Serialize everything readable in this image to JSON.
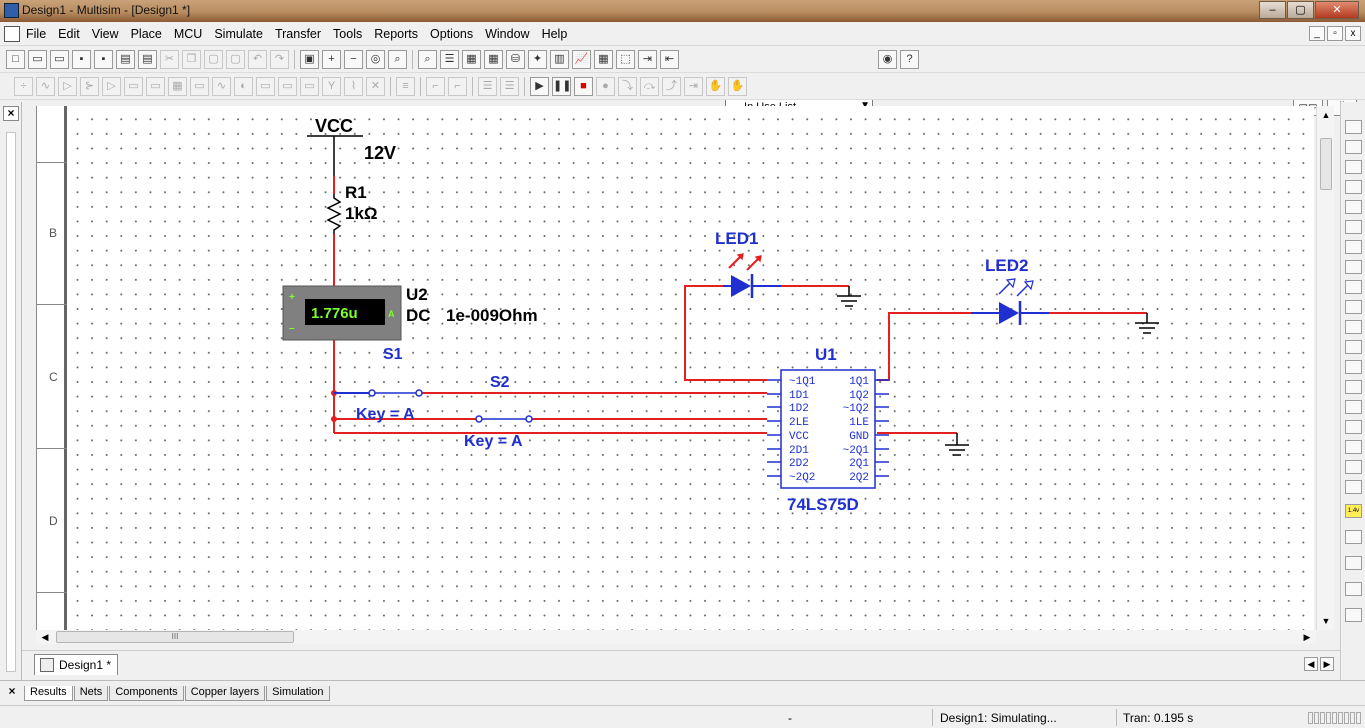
{
  "window": {
    "title": "Design1 - Multisim - [Design1 *]",
    "min": "–",
    "max": "▢",
    "close": "✕"
  },
  "menu": [
    "File",
    "Edit",
    "View",
    "Place",
    "MCU",
    "Simulate",
    "Transfer",
    "Tools",
    "Reports",
    "Options",
    "Window",
    "Help"
  ],
  "mdi_buttons": [
    "_",
    "▫",
    "x"
  ],
  "toolbar": {
    "in_use_list": "--- In Use List ---"
  },
  "sheet_border": {
    "rows": [
      "B",
      "C",
      "D"
    ]
  },
  "schematic": {
    "vcc_label": "VCC",
    "vcc_value": "12V",
    "r1_ref": "R1",
    "r1_value": "1kΩ",
    "u2_ref": "U2",
    "u2_reading": "1.776u",
    "u2_mode": "DC",
    "u2_resistance": "1e-009Ohm",
    "meter_plus": "+",
    "meter_minus": "–",
    "meter_unit": "A",
    "s1_ref": "S1",
    "s1_key": "Key = A",
    "s2_ref": "S2",
    "s2_key": "Key = A",
    "led1_ref": "LED1",
    "led2_ref": "LED2",
    "u1_ref": "U1",
    "u1_part": "74LS75D",
    "u1_pins_left": [
      "~1Q1",
      "1D1",
      "1D2",
      "2LE",
      "VCC",
      "2D1",
      "2D2",
      "~2Q2"
    ],
    "u1_pins_right": [
      "1Q1",
      "1Q2",
      "~1Q2",
      "1LE",
      "GND",
      "~2Q1",
      "2Q1",
      "2Q2"
    ]
  },
  "scrollbar": {
    "grip": "III"
  },
  "tabs": {
    "doc": "Design1 *"
  },
  "spreadsheet": {
    "close": "×",
    "tabs": [
      "Results",
      "Nets",
      "Components",
      "Copper layers",
      "Simulation"
    ]
  },
  "instruments": {
    "meter_label": "1.4v"
  },
  "status": {
    "left": "-",
    "middle": "Design1: Simulating...",
    "right": "Tran: 0.195 s"
  },
  "colors": {
    "wire": "#e41f1f",
    "component": "#1f2fd0",
    "label_blue": "#1f2fd0",
    "meter_green": "#7dff2a"
  }
}
